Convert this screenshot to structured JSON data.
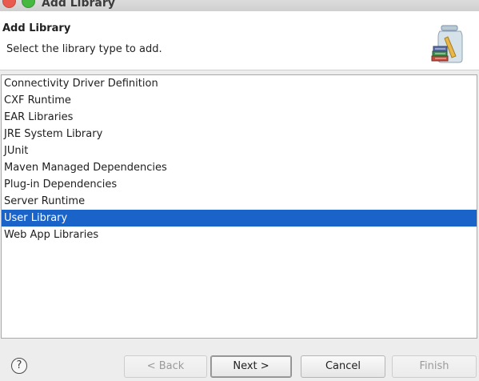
{
  "window": {
    "title": "Add Library"
  },
  "banner": {
    "title": "Add Library",
    "description": "Select the library type to add.",
    "icon": "library-jar-books-icon"
  },
  "library_types": [
    {
      "label": "Connectivity Driver Definition",
      "selected": false
    },
    {
      "label": "CXF Runtime",
      "selected": false
    },
    {
      "label": "EAR Libraries",
      "selected": false
    },
    {
      "label": "JRE System Library",
      "selected": false
    },
    {
      "label": "JUnit",
      "selected": false
    },
    {
      "label": "Maven Managed Dependencies",
      "selected": false
    },
    {
      "label": "Plug-in Dependencies",
      "selected": false
    },
    {
      "label": "Server Runtime",
      "selected": false
    },
    {
      "label": "User Library",
      "selected": true
    },
    {
      "label": "Web App Libraries",
      "selected": false
    }
  ],
  "buttons": {
    "help": "?",
    "back": "< Back",
    "next": "Next >",
    "cancel": "Cancel",
    "finish": "Finish"
  },
  "colors": {
    "selection": "#1a63c9",
    "close": "#e95b4f",
    "maximize": "#45b83f"
  }
}
